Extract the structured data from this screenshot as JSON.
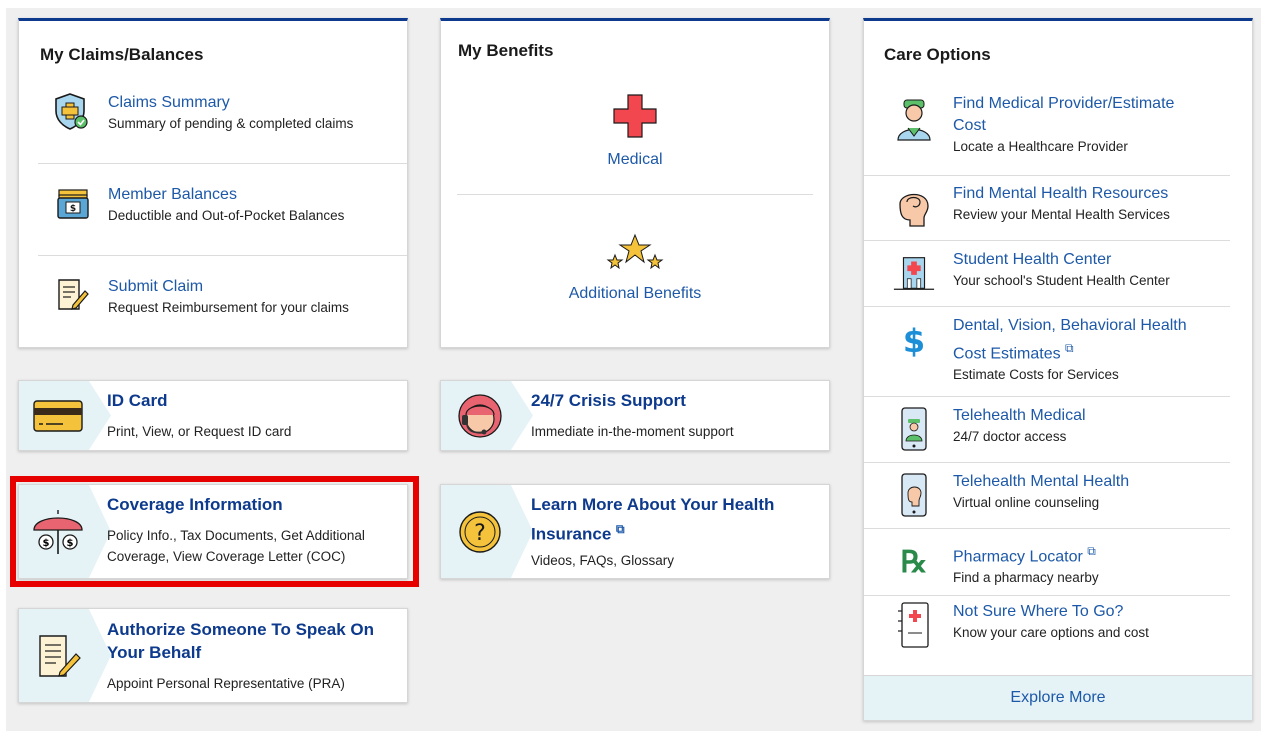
{
  "claims": {
    "title": "My Claims/Balances",
    "items": [
      {
        "label": "Claims Summary",
        "desc": "Summary of pending & completed claims",
        "icon": "shield-check-icon"
      },
      {
        "label": "Member Balances",
        "desc": "Deductible and Out-of-Pocket Balances",
        "icon": "wallet-icon"
      },
      {
        "label": "Submit Claim",
        "desc": "Request Reimbursement for your claims",
        "icon": "form-pencil-icon"
      }
    ]
  },
  "benefits": {
    "title": "My Benefits",
    "medical": "Medical",
    "additional": "Additional Benefits"
  },
  "tiles": {
    "id_card": {
      "title": "ID Card",
      "desc": "Print, View, or Request ID card"
    },
    "crisis": {
      "title": "24/7 Crisis Support",
      "desc": "Immediate in-the-moment support"
    },
    "coverage": {
      "title": "Coverage Information",
      "desc1": "Policy Info., Tax Documents, Get Additional",
      "desc2": "Coverage, View Coverage Letter (COC)"
    },
    "learn": {
      "title1": "Learn More About Your Health",
      "title2": "Insurance",
      "desc": "Videos, FAQs, Glossary"
    },
    "authorize": {
      "title1": "Authorize Someone To Speak On",
      "title2": "Your Behalf",
      "desc": "Appoint Personal Representative (PRA)"
    }
  },
  "care": {
    "title": "Care Options",
    "items": [
      {
        "label1": "Find Medical Provider/Estimate",
        "label2": "Cost",
        "desc": "Locate a Healthcare Provider",
        "icon": "doctor-icon"
      },
      {
        "label1": "Find Mental Health Resources",
        "desc": "Review your Mental Health Services",
        "icon": "head-brain-icon"
      },
      {
        "label1": "Student Health Center",
        "desc": "Your school's Student Health Center",
        "icon": "hospital-icon"
      },
      {
        "label1": "Dental, Vision, Behavioral Health",
        "label2": "Cost Estimates",
        "desc": "Estimate Costs for Services",
        "icon": "dollar-icon"
      },
      {
        "label1": "Telehealth Medical",
        "desc": "24/7 doctor access",
        "icon": "phone-doctor-icon"
      },
      {
        "label1": "Telehealth Mental Health",
        "desc": "Virtual online counseling",
        "icon": "phone-head-icon"
      },
      {
        "label1": "Pharmacy Locator",
        "desc": "Find a pharmacy nearby",
        "icon": "rx-icon"
      },
      {
        "label1": "Not Sure Where To Go?",
        "desc": "Know your care options and cost",
        "icon": "notebook-cross-icon"
      }
    ],
    "explore": "Explore More"
  },
  "colors": {
    "accent": "#0d3a8c",
    "link": "#1d59a8",
    "highlight": "#e60000",
    "tile_bg": "#e6f3f6"
  }
}
